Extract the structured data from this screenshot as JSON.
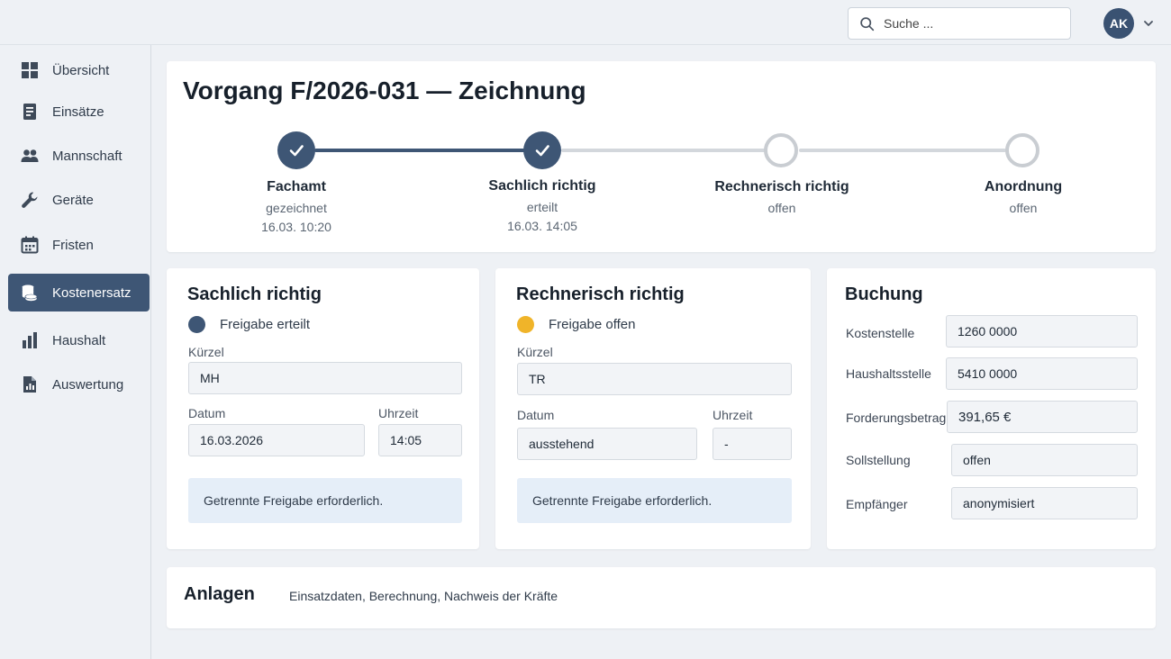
{
  "header": {
    "search_placeholder": "Suche ...",
    "avatar_initials": "AK"
  },
  "sidebar": {
    "items": [
      {
        "label": "Übersicht",
        "icon": "dashboard-icon"
      },
      {
        "label": "Einsätze",
        "icon": "document-icon"
      },
      {
        "label": "Mannschaft",
        "icon": "people-icon"
      },
      {
        "label": "Geräte",
        "icon": "wrench-icon"
      },
      {
        "label": "Fristen",
        "icon": "calendar-icon"
      },
      {
        "label": "Kostenersatz",
        "icon": "coins-icon",
        "active": true
      },
      {
        "label": "Haushalt",
        "icon": "bar-chart-icon"
      },
      {
        "label": "Auswertung",
        "icon": "report-icon"
      }
    ]
  },
  "main": {
    "title": "Vorgang F/2026-031 — Zeichnung",
    "steps": [
      {
        "name": "Fachamt",
        "status": "gezeichnet",
        "date": "16.03. 10:20",
        "done": true
      },
      {
        "name": "Sachlich richtig",
        "status": "erteilt",
        "date": "16.03. 14:05",
        "done": true
      },
      {
        "name": "Rechnerisch richtig",
        "status": "offen",
        "date": "",
        "done": false
      },
      {
        "name": "Anordnung",
        "status": "offen",
        "date": "",
        "done": false
      }
    ]
  },
  "sachlich": {
    "title": "Sachlich richtig",
    "status": "Freigabe erteilt",
    "status_color": "#3e5675",
    "kuerzel_label": "Kürzel",
    "kuerzel": "MH",
    "datum_label": "Datum",
    "datum": "16.03.2026",
    "uhrzeit_label": "Uhrzeit",
    "uhrzeit": "14:05",
    "hint": "Getrennte Freigabe erforderlich."
  },
  "rechnerisch": {
    "title": "Rechnerisch richtig",
    "status": "Freigabe offen",
    "status_color": "#f0b429",
    "kuerzel_label": "Kürzel",
    "kuerzel": "TR",
    "datum_label": "Datum",
    "datum": "ausstehend",
    "uhrzeit_label": "Uhrzeit",
    "uhrzeit": "-",
    "hint": "Getrennte Freigabe erforderlich."
  },
  "buchung": {
    "title": "Buchung",
    "rows": [
      {
        "label": "Kostenstelle",
        "value": "1260 0000"
      },
      {
        "label": "Haushaltsstelle",
        "value": "5410 0000"
      },
      {
        "label": "Forderungsbetrag",
        "value": "391,65 €"
      },
      {
        "label": "Sollstellung",
        "value": "offen"
      },
      {
        "label": "Empfänger",
        "value": "anonymisiert"
      }
    ]
  },
  "anlagen": {
    "title": "Anlagen",
    "text": "Einsatzdaten, Berechnung, Nachweis der Kräfte"
  },
  "colors": {
    "accent": "#3e5675",
    "warning": "#f0b429",
    "step_open": "#c9cdd2"
  }
}
